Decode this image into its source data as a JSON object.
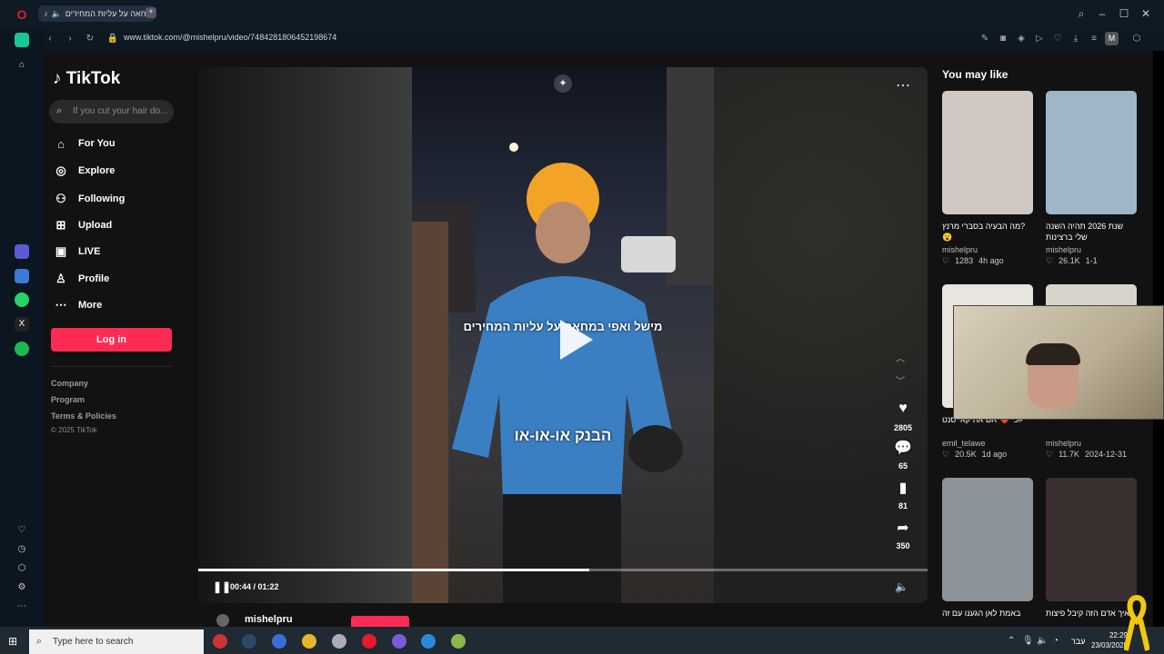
{
  "browser": {
    "tab_title": "המחאה על עליות המחירים",
    "new_tab": "+",
    "url": "www.tiktok.com/@mishelpru/video/7484281806452198674",
    "profile_initial": "M"
  },
  "sidebar": {
    "logo": "TikTok",
    "search_placeholder": "If you cut your hair do...",
    "nav": [
      {
        "label": "For You",
        "icon": "home-icon"
      },
      {
        "label": "Explore",
        "icon": "compass-icon"
      },
      {
        "label": "Following",
        "icon": "following-icon"
      },
      {
        "label": "Upload",
        "icon": "upload-icon"
      },
      {
        "label": "LIVE",
        "icon": "live-icon"
      },
      {
        "label": "Profile",
        "icon": "profile-icon"
      },
      {
        "label": "More",
        "icon": "more-icon"
      }
    ],
    "login_label": "Log in",
    "footer_links": [
      "Company",
      "Program",
      "Terms & Policies"
    ],
    "copyright": "© 2025 TikTok"
  },
  "video": {
    "caption_top": "מישל ואפי במחאה על עליות המחירים",
    "caption_bottom": "הבנק או-או-או",
    "time": "00:44 / 01:22",
    "progress": 0.536,
    "author": "mishelpru",
    "likes": "2805",
    "comments": "65",
    "saves": "81",
    "shares": "350"
  },
  "recommendations": {
    "heading": "You may like",
    "items": [
      {
        "title": "?מה הבעיה בסברי מרנץ 😮",
        "author": "mishelpru",
        "likes": "1283",
        "age": "4h ago",
        "color": "#cfc9c2"
      },
      {
        "title": "שנת 2026 תהיה השנה שלי ברצינות",
        "author": "mishelpru",
        "likes": "26.1K",
        "age": "1-1",
        "color": "#9fb6c8"
      },
      {
        "title": "#כי ❤️ BR את קאי סנט",
        "author": "emil_telawe",
        "likes": "20.5K",
        "age": "1d ago",
        "color": "#e8e4de"
      },
      {
        "title": "",
        "author": "mishelpru",
        "likes": "11.7K",
        "age": "2024-12-31",
        "color": "#d8d4cc"
      },
      {
        "title": "באמת לאן הגענו עם זה",
        "author": "",
        "likes": "",
        "age": "",
        "color": "#8c949a"
      },
      {
        "title": "איך אדם הזה קיבל פיצות",
        "author": "",
        "likes": "",
        "age": "",
        "color": "#3a3030"
      }
    ]
  },
  "taskbar": {
    "search_placeholder": "Type here to search",
    "language": "עבר",
    "time": "22:29",
    "date": "23/03/2025"
  }
}
